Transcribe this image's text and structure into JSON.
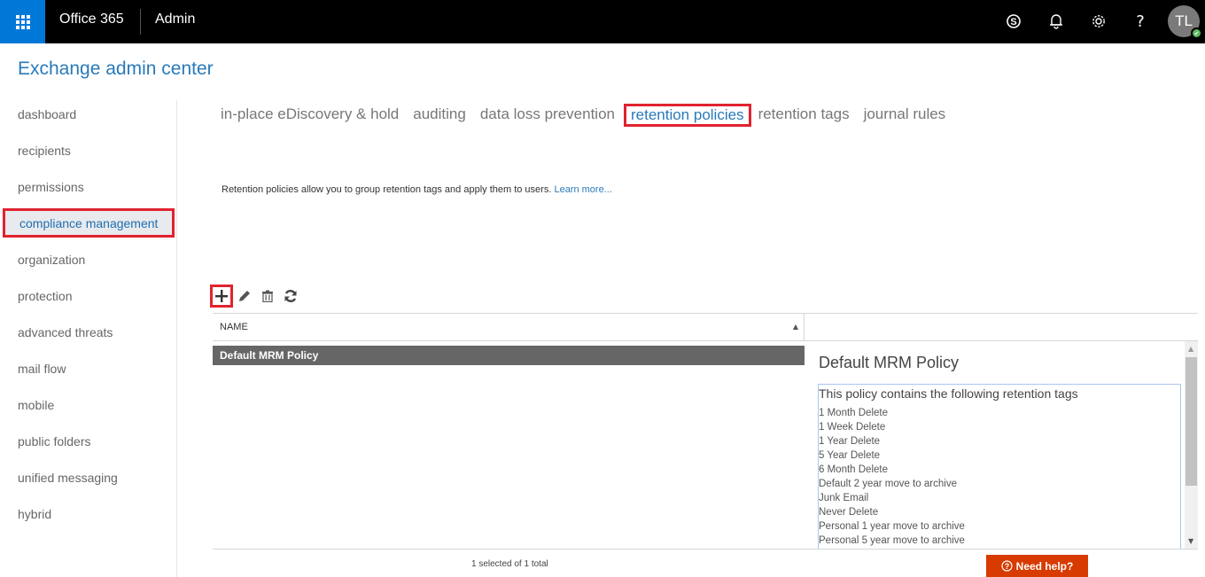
{
  "topbar": {
    "brand": "Office 365",
    "app": "Admin",
    "avatar_initials": "TL",
    "icons": [
      "skype-icon",
      "bell-icon",
      "gear-icon",
      "help-icon"
    ],
    "help_glyph": "?"
  },
  "page_title": "Exchange admin center",
  "sidebar": {
    "items": [
      {
        "label": "dashboard"
      },
      {
        "label": "recipients"
      },
      {
        "label": "permissions"
      },
      {
        "label": "compliance management",
        "active": true
      },
      {
        "label": "organization"
      },
      {
        "label": "protection"
      },
      {
        "label": "advanced threats"
      },
      {
        "label": "mail flow"
      },
      {
        "label": "mobile"
      },
      {
        "label": "public folders"
      },
      {
        "label": "unified messaging"
      },
      {
        "label": "hybrid"
      }
    ]
  },
  "tabs": [
    {
      "label": "in-place eDiscovery & hold"
    },
    {
      "label": "auditing"
    },
    {
      "label": "data loss prevention"
    },
    {
      "label": "retention policies",
      "active": true
    },
    {
      "label": "retention tags"
    },
    {
      "label": "journal rules"
    }
  ],
  "description": {
    "text": "Retention policies allow you to group retention tags and apply them to users.",
    "link": "Learn more..."
  },
  "toolbar": {
    "add": "add-icon",
    "edit": "edit-icon",
    "delete": "delete-icon",
    "refresh": "refresh-icon"
  },
  "grid": {
    "column_header": "NAME",
    "sort": "ascending",
    "rows": [
      {
        "name": "Default MRM Policy",
        "selected": true
      }
    ]
  },
  "details": {
    "title": "Default MRM Policy",
    "intro": "This policy contains the following retention tags",
    "tags": [
      "1 Month Delete",
      "1 Week Delete",
      "1 Year Delete",
      "5 Year Delete",
      "6 Month Delete",
      "Default 2 year move to archive",
      "Junk Email",
      "Never Delete",
      "Personal 1 year move to archive",
      "Personal 5 year move to archive"
    ]
  },
  "status": "1 selected of 1 total",
  "help_button": "Need help?",
  "colors": {
    "accent_blue": "#0078d7",
    "link_blue": "#2a7ab9",
    "highlight_red": "#e0232f",
    "help_orange": "#d83b01",
    "selected_row": "#666666"
  }
}
